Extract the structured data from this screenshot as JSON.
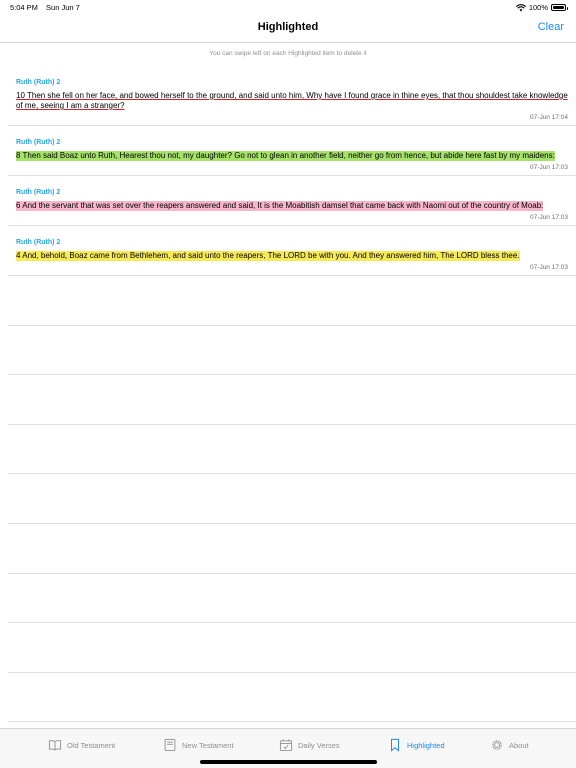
{
  "status": {
    "time": "5:04 PM",
    "date": "Sun Jun 7",
    "battery": "100%"
  },
  "nav": {
    "title": "Highlighted",
    "clear_label": "Clear"
  },
  "hint": "You can swipe left on each Highlighted item to delete it",
  "items": [
    {
      "ref": "Ruth (Ruth) 2",
      "text": "10 Then she fell on her face, and bowed herself to the ground, and said unto him, Why have I found grace in thine eyes, that thou shouldest take knowledge of me, seeing I am a stranger?",
      "time": "07-Jun 17:04",
      "style": "underline"
    },
    {
      "ref": "Ruth (Ruth) 2",
      "text": "8 Then said Boaz unto Ruth, Hearest thou not, my daughter? Go not to glean in another field, neither go from hence, but abide here fast by my maidens:",
      "time": "07-Jun 17:03",
      "style": "green"
    },
    {
      "ref": "Ruth (Ruth) 2",
      "text": "6 And the servant that was set over the reapers answered and said, It is the Moabitish damsel that came back with Naomi out of the country of Moab:",
      "time": "07-Jun 17:03",
      "style": "pink"
    },
    {
      "ref": "Ruth (Ruth) 2",
      "text": "4 And, behold, Boaz came from Bethlehem, and said unto the reapers, The LORD be with you. And they answered him, The LORD bless thee.",
      "time": "07-Jun 17:03",
      "style": "yellow"
    }
  ],
  "tabs": [
    {
      "label": "Old Testament",
      "icon": "book-icon"
    },
    {
      "label": "New Testament",
      "icon": "bible-icon"
    },
    {
      "label": "Daily Verses",
      "icon": "calendar-check-icon"
    },
    {
      "label": "Highlighted",
      "icon": "bookmark-icon",
      "active": true
    },
    {
      "label": "About",
      "icon": "gear-icon"
    }
  ]
}
